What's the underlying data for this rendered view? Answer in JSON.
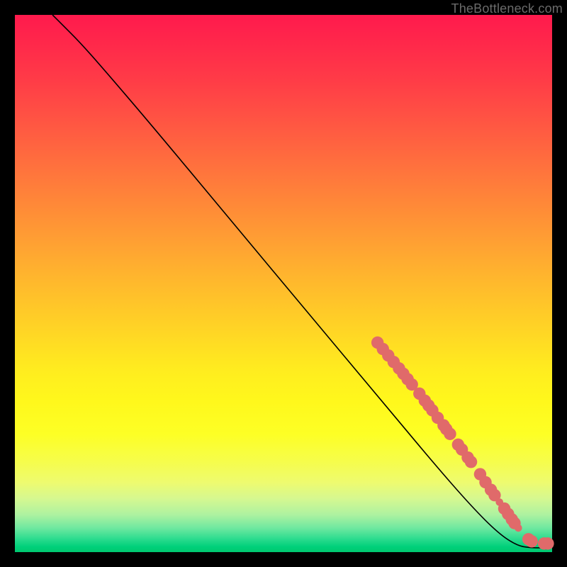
{
  "attribution": "TheBottleneck.com",
  "colors": {
    "dot": "#e06a6a",
    "curve": "#000000"
  },
  "chart_data": {
    "type": "line",
    "title": "",
    "xlabel": "",
    "ylabel": "",
    "xlim": [
      0,
      100
    ],
    "ylim": [
      0,
      100
    ],
    "grid": false,
    "legend": false,
    "curve": [
      {
        "x": 7,
        "y": 100
      },
      {
        "x": 9,
        "y": 98
      },
      {
        "x": 12,
        "y": 95
      },
      {
        "x": 16,
        "y": 90.5
      },
      {
        "x": 25,
        "y": 80
      },
      {
        "x": 40,
        "y": 62
      },
      {
        "x": 55,
        "y": 44
      },
      {
        "x": 68,
        "y": 28.5
      },
      {
        "x": 78,
        "y": 16.5
      },
      {
        "x": 85,
        "y": 8.5
      },
      {
        "x": 90,
        "y": 3.5
      },
      {
        "x": 93.5,
        "y": 1.2
      },
      {
        "x": 96,
        "y": 0.8
      },
      {
        "x": 98,
        "y": 0.8
      },
      {
        "x": 99,
        "y": 0.8
      }
    ],
    "dots_large_r": 1.15,
    "dots_small_r": 0.7,
    "dots": [
      {
        "x": 67.5,
        "y": 39.0,
        "size": "L"
      },
      {
        "x": 68.5,
        "y": 37.8,
        "size": "L"
      },
      {
        "x": 69.5,
        "y": 36.6,
        "size": "L"
      },
      {
        "x": 70.5,
        "y": 35.4,
        "size": "L"
      },
      {
        "x": 71.5,
        "y": 34.2,
        "size": "L"
      },
      {
        "x": 72.3,
        "y": 33.2,
        "size": "L"
      },
      {
        "x": 73.1,
        "y": 32.2,
        "size": "L"
      },
      {
        "x": 73.9,
        "y": 31.2,
        "size": "L"
      },
      {
        "x": 75.3,
        "y": 29.5,
        "size": "L"
      },
      {
        "x": 76.3,
        "y": 28.2,
        "size": "L"
      },
      {
        "x": 77.0,
        "y": 27.3,
        "size": "L"
      },
      {
        "x": 77.7,
        "y": 26.4,
        "size": "L"
      },
      {
        "x": 78.7,
        "y": 25.0,
        "size": "L"
      },
      {
        "x": 79.8,
        "y": 23.6,
        "size": "L"
      },
      {
        "x": 80.3,
        "y": 22.9,
        "size": "L"
      },
      {
        "x": 81.0,
        "y": 22.0,
        "size": "L"
      },
      {
        "x": 82.5,
        "y": 20.0,
        "size": "L"
      },
      {
        "x": 83.2,
        "y": 19.1,
        "size": "L"
      },
      {
        "x": 84.3,
        "y": 17.6,
        "size": "L"
      },
      {
        "x": 84.9,
        "y": 16.8,
        "size": "L"
      },
      {
        "x": 86.6,
        "y": 14.5,
        "size": "L"
      },
      {
        "x": 87.6,
        "y": 13.0,
        "size": "L"
      },
      {
        "x": 88.6,
        "y": 11.6,
        "size": "L"
      },
      {
        "x": 89.3,
        "y": 10.6,
        "size": "L"
      },
      {
        "x": 90.2,
        "y": 9.3,
        "size": "S"
      },
      {
        "x": 91.1,
        "y": 8.1,
        "size": "L"
      },
      {
        "x": 91.8,
        "y": 7.1,
        "size": "L"
      },
      {
        "x": 92.5,
        "y": 6.1,
        "size": "L"
      },
      {
        "x": 93.0,
        "y": 5.4,
        "size": "L"
      },
      {
        "x": 93.7,
        "y": 4.5,
        "size": "S"
      },
      {
        "x": 95.6,
        "y": 2.4,
        "size": "L"
      },
      {
        "x": 96.2,
        "y": 2.0,
        "size": "L"
      },
      {
        "x": 98.5,
        "y": 1.6,
        "size": "L"
      },
      {
        "x": 99.2,
        "y": 1.6,
        "size": "L"
      }
    ]
  }
}
